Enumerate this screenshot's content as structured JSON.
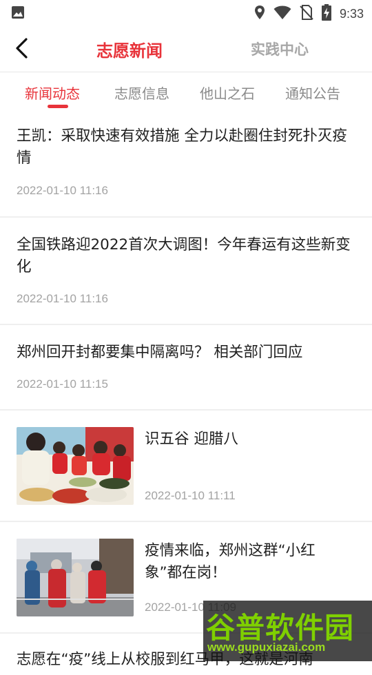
{
  "status_bar": {
    "time": "9:33"
  },
  "header": {
    "back_icon": "chevron-left-icon",
    "title": "志愿新闻",
    "side_title": "实践中心"
  },
  "tabs": [
    {
      "label": "新闻动态",
      "active": true
    },
    {
      "label": "志愿信息"
    },
    {
      "label": "他山之石"
    },
    {
      "label": "通知公告"
    }
  ],
  "news": [
    {
      "title": "王凯：采取快速有效措施 全力以赴圈住封死扑灭疫情",
      "date": "2022-01-10 11:16"
    },
    {
      "title": "全国铁路迎2022首次大调图！今年春运有这些新变化",
      "date": "2022-01-10 11:16"
    },
    {
      "title": "郑州回开封都要集中隔离吗？ 相关部门回应",
      "date": "2022-01-10 11:15"
    },
    {
      "title": "识五谷 迎腊八",
      "date": "2022-01-10 11:11"
    },
    {
      "title": "疫情来临，郑州这群“小红象”都在岗！",
      "date": "2022-01-10 11:09"
    },
    {
      "title": "志愿在“疫”线上从校服到红马甲，这就是河南"
    }
  ],
  "watermark": {
    "main": "谷普软件园",
    "sub": "www.gupuxiazai.com"
  },
  "colors": {
    "accent": "#e8333a",
    "muted": "#a3a3a3",
    "divider": "#efefef"
  }
}
